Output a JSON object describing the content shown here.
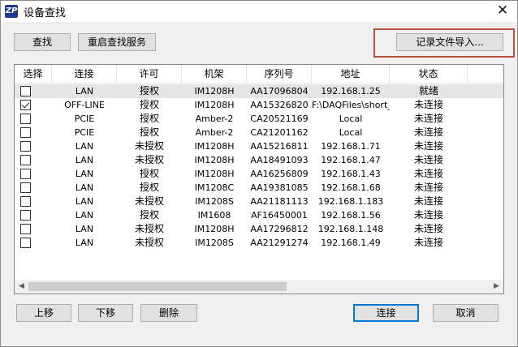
{
  "window": {
    "title": "设备查找",
    "icon_label": "ZP",
    "close_glyph": "✕"
  },
  "toolbar": {
    "find_label": "查找",
    "restart_label": "重启查找服务",
    "import_label": "记录文件导入..."
  },
  "table": {
    "headers": [
      "选择",
      "连接",
      "许可",
      "机架",
      "序列号",
      "地址",
      "状态"
    ],
    "rows": [
      {
        "checked": false,
        "selected": true,
        "conn": "LAN",
        "license": "授权",
        "rack": "IM1208H",
        "serial": "AA17096804",
        "address": "192.168.1.25",
        "status": "就绪",
        "extra": ""
      },
      {
        "checked": true,
        "selected": false,
        "conn": "OFF-LINE",
        "license": "授权",
        "rack": "IM1208H",
        "serial": "AA15326820",
        "address": "F:\\DAQFiles\\short_...",
        "status": "未连接",
        "extra": ""
      },
      {
        "checked": false,
        "selected": false,
        "conn": "PCIE",
        "license": "授权",
        "rack": "Amber-2",
        "serial": "CA20521169",
        "address": "Local",
        "status": "未连接",
        "extra": ""
      },
      {
        "checked": false,
        "selected": false,
        "conn": "PCIE",
        "license": "授权",
        "rack": "Amber-2",
        "serial": "CA21201162",
        "address": "Local",
        "status": "未连接",
        "extra": ""
      },
      {
        "checked": false,
        "selected": false,
        "conn": "LAN",
        "license": "未授权",
        "rack": "IM1208H",
        "serial": "AA15216811",
        "address": "192.168.1.71",
        "status": "未连接",
        "extra": ""
      },
      {
        "checked": false,
        "selected": false,
        "conn": "LAN",
        "license": "未授权",
        "rack": "IM1208H",
        "serial": "AA18491093",
        "address": "192.168.1.47",
        "status": "未连接",
        "extra": "I"
      },
      {
        "checked": false,
        "selected": false,
        "conn": "LAN",
        "license": "授权",
        "rack": "IM1208H",
        "serial": "AA16256809",
        "address": "192.168.1.43",
        "status": "未连接",
        "extra": ""
      },
      {
        "checked": false,
        "selected": false,
        "conn": "LAN",
        "license": "授权",
        "rack": "IM1208C",
        "serial": "AA19381085",
        "address": "192.168.1.68",
        "status": "未连接",
        "extra": ""
      },
      {
        "checked": false,
        "selected": false,
        "conn": "LAN",
        "license": "未授权",
        "rack": "IM1208S",
        "serial": "AA21181113",
        "address": "192.168.1.183",
        "status": "未连接",
        "extra": ""
      },
      {
        "checked": false,
        "selected": false,
        "conn": "LAN",
        "license": "授权",
        "rack": "IM1608",
        "serial": "AF16450001",
        "address": "192.168.1.56",
        "status": "未连接",
        "extra": "I"
      },
      {
        "checked": false,
        "selected": false,
        "conn": "LAN",
        "license": "未授权",
        "rack": "IM1208H",
        "serial": "AA17296812",
        "address": "192.168.1.148",
        "status": "未连接",
        "extra": ""
      },
      {
        "checked": false,
        "selected": false,
        "conn": "LAN",
        "license": "未授权",
        "rack": "IM1208S",
        "serial": "AA21291274",
        "address": "192.168.1.49",
        "status": "未连接",
        "extra": "I"
      }
    ]
  },
  "scrollbar": {
    "left_glyph": "◀",
    "right_glyph": "▶"
  },
  "footer": {
    "up_label": "上移",
    "down_label": "下移",
    "delete_label": "删除",
    "connect_label": "连接",
    "cancel_label": "取消"
  },
  "colors": {
    "accent": "#0078d7",
    "highlight_box": "#b5533c",
    "selected_row": "#e5e5e5"
  }
}
